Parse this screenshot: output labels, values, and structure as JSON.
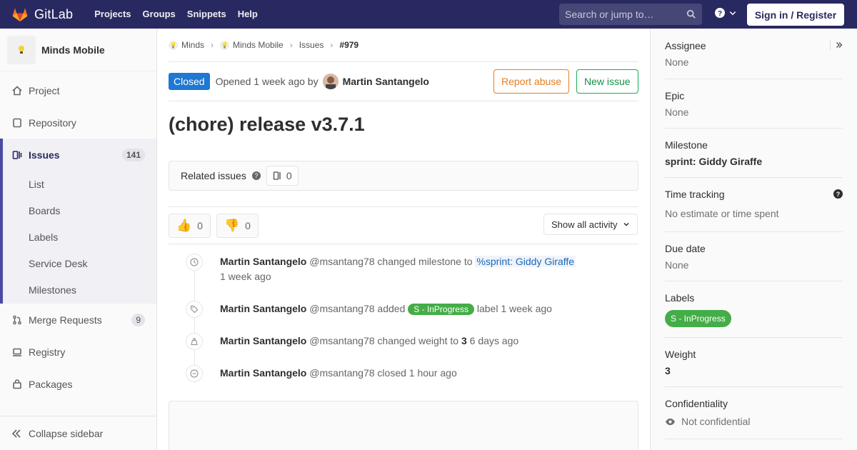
{
  "topbar": {
    "brand": "GitLab",
    "nav": [
      "Projects",
      "Groups",
      "Snippets",
      "Help"
    ],
    "search_placeholder": "Search or jump to…",
    "signin_label": "Sign in / Register"
  },
  "sidebar": {
    "project_name": "Minds Mobile",
    "items": [
      {
        "label": "Project",
        "icon": "home-icon"
      },
      {
        "label": "Repository",
        "icon": "doc-icon"
      }
    ],
    "issues": {
      "label": "Issues",
      "count": "141",
      "sub": [
        "List",
        "Boards",
        "Labels",
        "Service Desk",
        "Milestones"
      ]
    },
    "items_after": [
      {
        "label": "Merge Requests",
        "count": "9"
      },
      {
        "label": "Registry"
      },
      {
        "label": "Packages"
      }
    ],
    "collapse_label": "Collapse sidebar"
  },
  "breadcrumb": [
    "Minds",
    "Minds Mobile",
    "Issues",
    "#979"
  ],
  "issue": {
    "status": "Closed",
    "opened_text": "Opened 1 week ago by",
    "author": "Martin Santangelo",
    "report_label": "Report abuse",
    "new_label": "New issue",
    "title": "(chore) release v3.7.1"
  },
  "related": {
    "label": "Related issues",
    "count": "0"
  },
  "awards": {
    "thumbs_up": "0",
    "thumbs_down": "0",
    "activity_filter": "Show all activity"
  },
  "timeline": [
    {
      "author": "Martin Santangelo",
      "handle": "@msantang78",
      "text": "changed milestone to",
      "link": "%sprint: Giddy Giraffe",
      "time": "1 week ago"
    },
    {
      "author": "Martin Santangelo",
      "handle": "@msantang78",
      "text": "added",
      "label": "S - InProgress",
      "after": "label",
      "time": "1 week ago"
    },
    {
      "author": "Martin Santangelo",
      "handle": "@msantang78",
      "text": "changed weight to",
      "value": "3",
      "time": "6 days ago"
    },
    {
      "author": "Martin Santangelo",
      "handle": "@msantang78",
      "text": "closed",
      "time": "1 hour ago"
    }
  ],
  "right_sidebar": {
    "assignee": {
      "label": "Assignee",
      "value": "None"
    },
    "epic": {
      "label": "Epic",
      "value": "None"
    },
    "milestone": {
      "label": "Milestone",
      "value": "sprint: Giddy Giraffe"
    },
    "time_tracking": {
      "label": "Time tracking",
      "value": "No estimate or time spent"
    },
    "due_date": {
      "label": "Due date",
      "value": "None"
    },
    "labels": {
      "label": "Labels",
      "value": "S - InProgress"
    },
    "weight": {
      "label": "Weight",
      "value": "3"
    },
    "confidentiality": {
      "label": "Confidentiality",
      "value": "Not confidential"
    }
  },
  "colors": {
    "topbar": "#292961",
    "status_closed": "#1f78d1",
    "label_green": "#44ad47",
    "report": "#e67e22",
    "new_issue": "#1aaa55"
  }
}
